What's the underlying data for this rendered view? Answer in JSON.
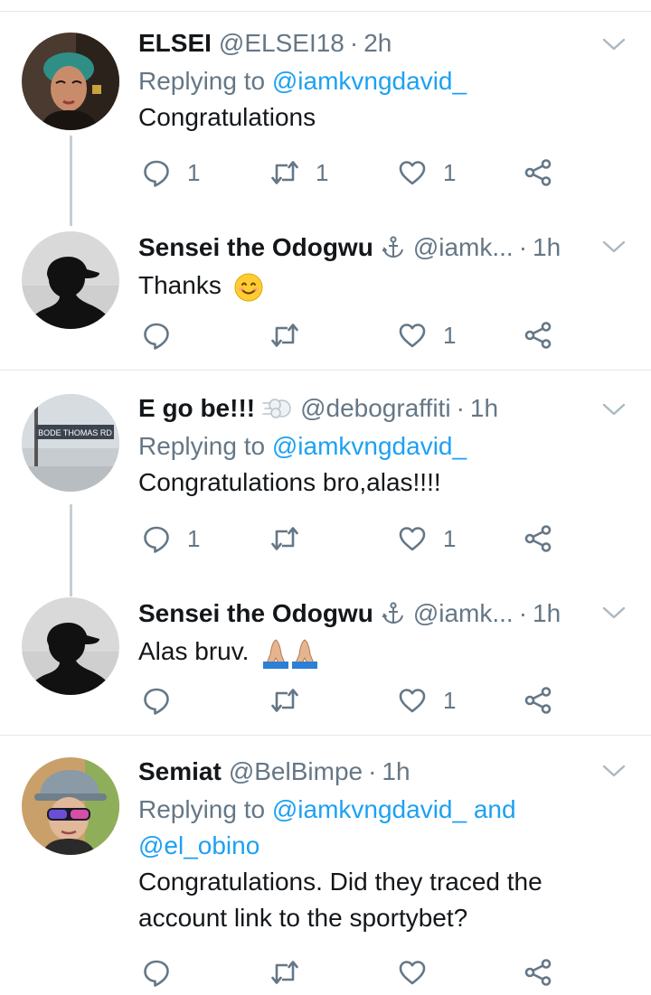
{
  "tweets": [
    {
      "name": "ELSEI",
      "handle": "@ELSEI18",
      "separator": "·",
      "time": "2h",
      "reply_prefix": "Replying to",
      "reply_to": "@iamkvngdavid_",
      "text": "Congratulations",
      "counts": {
        "reply": "1",
        "retweet": "1",
        "like": "1"
      }
    },
    {
      "name": "Sensei the Odogwu",
      "handle": "@iamk...",
      "separator": "·",
      "time": "1h",
      "text": "Thanks",
      "emoji": "smiling-face",
      "counts": {
        "reply": "",
        "retweet": "",
        "like": "1"
      }
    },
    {
      "name": "E go be!!!",
      "handle": "@debograffiti",
      "separator": "·",
      "time": "1h",
      "reply_prefix": "Replying to",
      "reply_to": "@iamkvngdavid_",
      "text": "Congratulations bro,alas!!!!",
      "avatar_sign": "BODE THOMAS RD",
      "counts": {
        "reply": "1",
        "retweet": "",
        "like": "1"
      }
    },
    {
      "name": "Sensei the Odogwu",
      "handle": "@iamk...",
      "separator": "·",
      "time": "1h",
      "text": "Alas bruv.",
      "emoji": "folded-hands x2",
      "counts": {
        "reply": "",
        "retweet": "",
        "like": "1"
      }
    },
    {
      "name": "Semiat",
      "handle": "@BelBimpe",
      "separator": "·",
      "time": "1h",
      "reply_prefix": "Replying to",
      "reply_to": "@iamkvngdavid_",
      "reply_and": "and",
      "reply_to_2": "@el_obino",
      "text_line1": "Congratulations. Did they traced the",
      "text_line2": "account link to the sportybet?",
      "counts": {
        "reply": "",
        "retweet": "",
        "like": ""
      }
    }
  ],
  "colors": {
    "link": "#1da1f2",
    "secondary": "#657786",
    "divider": "#e1e8ed",
    "thread_line": "#c4cfd6"
  },
  "icons": [
    "reply-icon",
    "retweet-icon",
    "like-icon",
    "share-icon",
    "chevron-down-icon",
    "anchor-icon",
    "dash-puff-icon"
  ]
}
